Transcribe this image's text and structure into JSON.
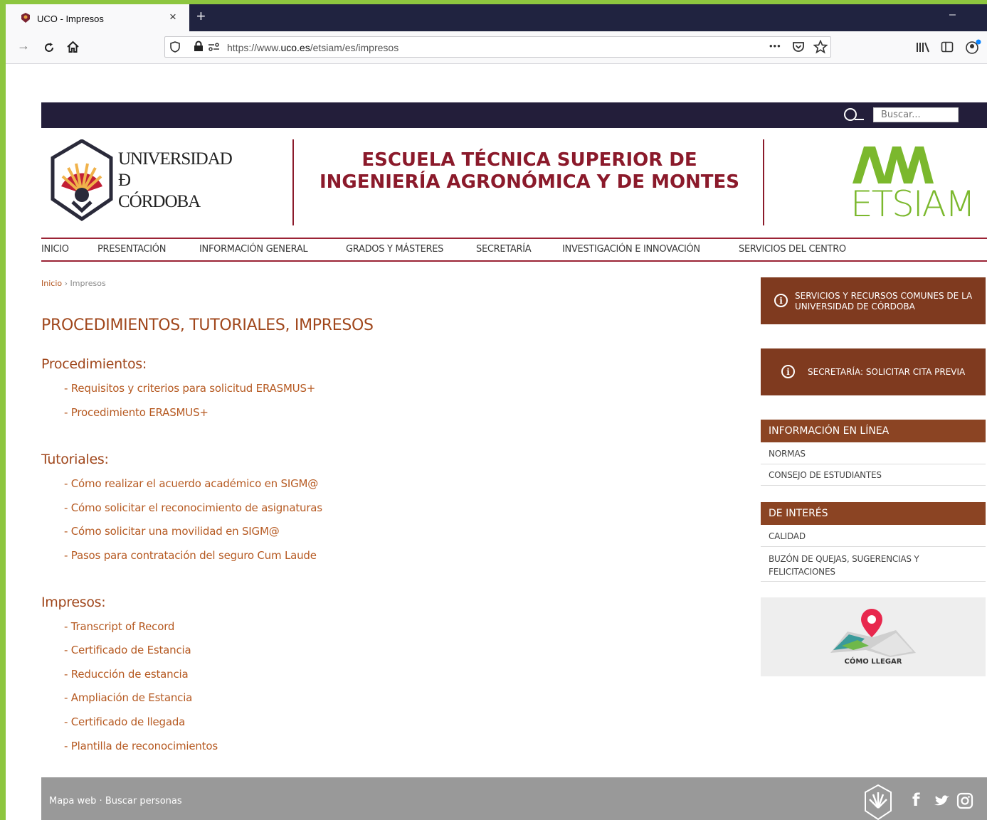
{
  "browser": {
    "tab_title": "UCO - Impresos",
    "tab_close": "×",
    "new_tab": "+",
    "minimize": "–",
    "url_prefix": "https://www.",
    "url_domain": "uco.es",
    "url_path": "/etsiam/es/impresos",
    "page_actions": "•••"
  },
  "search": {
    "placeholder": "Buscar..."
  },
  "header": {
    "uco_logo_lines": [
      "UNIVERSIDAD",
      "Ð",
      "CÓRDOBA"
    ],
    "school_title": "ESCUELA TÉCNICA SUPERIOR DE INGENIERÍA AGRONÓMICA Y DE MONTES",
    "etsiam_logo": "ETSIAM"
  },
  "nav": [
    "INICIO",
    "PRESENTACIÓN",
    "INFORMACIÓN GENERAL",
    "GRADOS Y MÁSTERES",
    "SECRETARÍA",
    "INVESTIGACIÓN E INNOVACIÓN",
    "SERVICIOS DEL CENTRO"
  ],
  "breadcrumb": {
    "home": "Inicio",
    "sep": " › ",
    "current": "Impresos"
  },
  "main": {
    "title": "PROCEDIMIENTOS, TUTORIALES, IMPRESOS",
    "sections": [
      {
        "heading": "Procedimientos:",
        "links": [
          "- Requisitos y criterios para solicitud ERASMUS+",
          "- Procedimiento ERASMUS+"
        ]
      },
      {
        "heading": "Tutoriales:",
        "links": [
          "- Cómo realizar el acuerdo académico en SIGM@",
          "- Cómo solicitar el reconocimiento de asignaturas",
          "- Cómo solicitar una movilidad en SIGM@",
          "- Pasos para contratación del seguro Cum Laude"
        ]
      },
      {
        "heading": "Impresos:",
        "links": [
          "- Transcript of Record",
          "- Certificado de Estancia",
          "- Reducción de estancia",
          "- Ampliación de Estancia",
          "- Certificado de llegada",
          "- Plantilla de reconocimientos"
        ]
      }
    ]
  },
  "sidebar": {
    "button1": "SERVICIOS Y RECURSOS COMUNES DE LA UNIVERSIDAD DE CÓRDOBA",
    "button2": "SECRETARÍA: SOLICITAR CITA PREVIA",
    "info_heading": "INFORMACIÓN EN LÍNEA",
    "info_items": [
      "NORMAS",
      "CONSEJO DE ESTUDIANTES"
    ],
    "interest_heading": "DE INTERÉS",
    "interest_items": [
      "CALIDAD",
      "BUZÓN DE QUEJAS, SUGERENCIAS Y FELICITACIONES"
    ],
    "map_label": "CÓMO LLEGAR"
  },
  "footer": {
    "links": "Mapa web · Buscar personas"
  },
  "colors": {
    "brand_red": "#8b1a2b",
    "brand_brown": "#7f3a1f",
    "link": "#b65a22",
    "accent_green": "#8dc63f"
  }
}
